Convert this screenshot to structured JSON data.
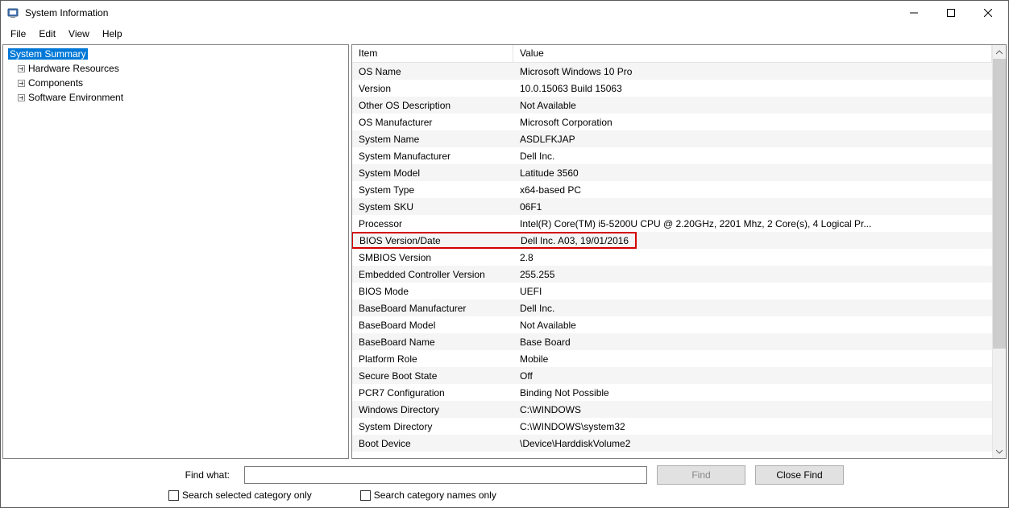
{
  "window": {
    "title": "System Information"
  },
  "menu": {
    "file": "File",
    "edit": "Edit",
    "view": "View",
    "help": "Help"
  },
  "tree": {
    "root": "System Summary",
    "children": [
      "Hardware Resources",
      "Components",
      "Software Environment"
    ]
  },
  "grid": {
    "headers": {
      "item": "Item",
      "value": "Value"
    },
    "rows": [
      {
        "item": "OS Name",
        "value": "Microsoft Windows 10 Pro"
      },
      {
        "item": "Version",
        "value": "10.0.15063 Build 15063"
      },
      {
        "item": "Other OS Description",
        "value": "Not Available"
      },
      {
        "item": "OS Manufacturer",
        "value": "Microsoft Corporation"
      },
      {
        "item": "System Name",
        "value": "ASDLFKJAP"
      },
      {
        "item": "System Manufacturer",
        "value": "Dell Inc."
      },
      {
        "item": "System Model",
        "value": "Latitude 3560"
      },
      {
        "item": "System Type",
        "value": "x64-based PC"
      },
      {
        "item": "System SKU",
        "value": "06F1"
      },
      {
        "item": "Processor",
        "value": "Intel(R) Core(TM) i5-5200U CPU @ 2.20GHz, 2201 Mhz, 2 Core(s), 4 Logical Pr..."
      },
      {
        "item": "BIOS Version/Date",
        "value": "Dell Inc. A03, 19/01/2016",
        "highlight": true
      },
      {
        "item": "SMBIOS Version",
        "value": "2.8"
      },
      {
        "item": "Embedded Controller Version",
        "value": "255.255"
      },
      {
        "item": "BIOS Mode",
        "value": "UEFI"
      },
      {
        "item": "BaseBoard Manufacturer",
        "value": "Dell Inc."
      },
      {
        "item": "BaseBoard Model",
        "value": "Not Available"
      },
      {
        "item": "BaseBoard Name",
        "value": "Base Board"
      },
      {
        "item": "Platform Role",
        "value": "Mobile"
      },
      {
        "item": "Secure Boot State",
        "value": "Off"
      },
      {
        "item": "PCR7 Configuration",
        "value": "Binding Not Possible"
      },
      {
        "item": "Windows Directory",
        "value": "C:\\WINDOWS"
      },
      {
        "item": "System Directory",
        "value": "C:\\WINDOWS\\system32"
      },
      {
        "item": "Boot Device",
        "value": "\\Device\\HarddiskVolume2"
      }
    ]
  },
  "find": {
    "label": "Find what:",
    "value": "",
    "find_btn": "Find",
    "close_btn": "Close Find",
    "chk1": "Search selected category only",
    "chk2": "Search category names only"
  }
}
